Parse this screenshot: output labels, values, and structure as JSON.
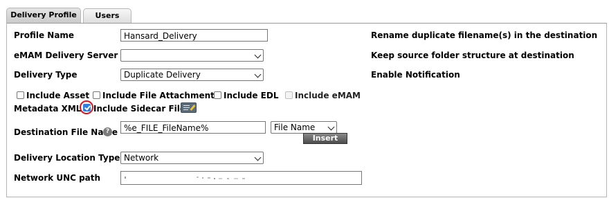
{
  "tabs": [
    {
      "label": "Delivery Profile",
      "active": true
    },
    {
      "label": "Users",
      "active": false
    }
  ],
  "form": {
    "profile_name_label": "Profile Name",
    "profile_name_value": "Hansard_Delivery",
    "delivery_server_label": "eMAM Delivery Server",
    "delivery_server_value": "",
    "delivery_type_label": "Delivery Type",
    "delivery_type_value": "Duplicate Delivery",
    "include_asset_label": "Include Asset",
    "include_file_attachments_label": "Include File Attachments",
    "include_edl_label": "Include EDL",
    "include_emam_label": "Include eMAM",
    "metadata_xml_label": "Metadata XML",
    "include_sidecar_label": "Include Sidecar File",
    "include_sidecar_checked": true,
    "destination_file_name_label": "Destination File Name",
    "destination_file_name_value": "%e_FILE_FileName%",
    "file_name_select_value": "File Name",
    "insert_button_label": "Insert",
    "delivery_location_type_label": "Delivery Location Type",
    "delivery_location_type_value": "Network",
    "network_unc_label": "Network UNC path",
    "network_unc_value": ""
  },
  "options": {
    "rename_duplicate_label": "Rename duplicate filename(s) in the destination",
    "keep_folder_structure_label": "Keep source folder structure at destination",
    "enable_notification_label": "Enable Notification"
  },
  "colors": {
    "accent_check": "#2f7fe0",
    "highlight_ring": "#e0141d",
    "tab_bg": "#d6d6d6"
  },
  "icons": {
    "help": "question-circle-icon",
    "sidecar_edit": "edit-note-icon"
  }
}
